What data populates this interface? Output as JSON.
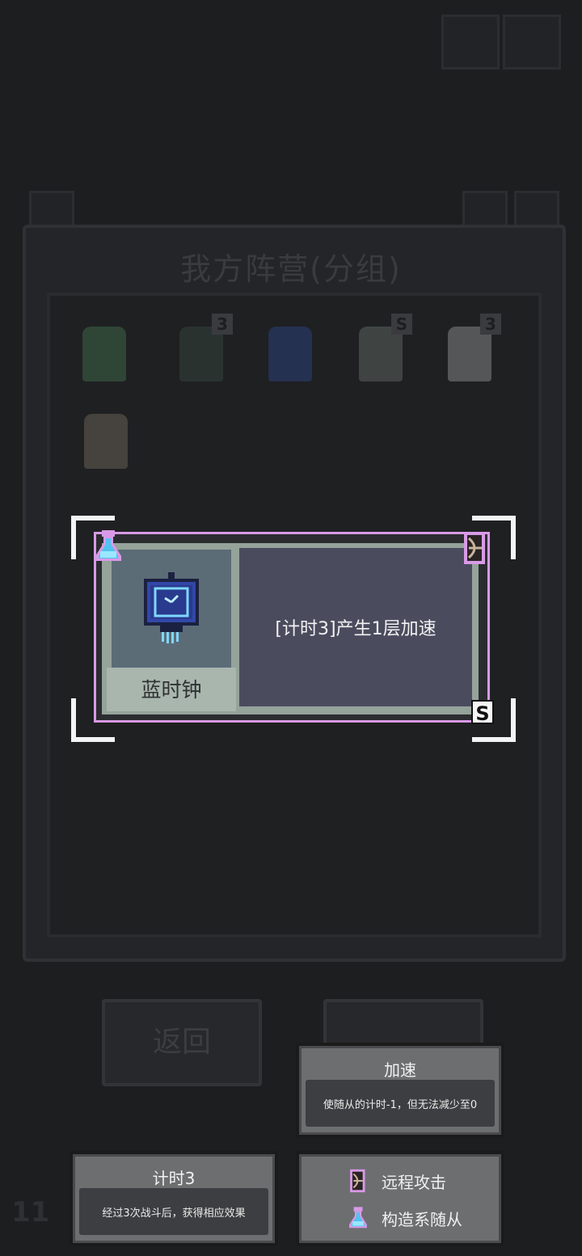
{
  "background": {
    "panel_title": "我方阵营(分组)",
    "return_button": "返回",
    "level_number": "11",
    "units": [
      {
        "name": "horned-warrior",
        "color": "#3c5a44",
        "badge": ""
      },
      {
        "name": "hooded-swordsman",
        "color": "#303a38",
        "badge": "3"
      },
      {
        "name": "blue-clock",
        "color": "#2c3a62",
        "badge": ""
      },
      {
        "name": "skeleton",
        "color": "#5d6462",
        "badge": "S"
      },
      {
        "name": "fox-spirit",
        "color": "#8a8a8a",
        "badge": "3"
      },
      {
        "name": "goat-sage",
        "color": "#6e6660",
        "badge": ""
      }
    ]
  },
  "card": {
    "name": "蓝时钟",
    "description": "[计时3]产生1层加速",
    "rank": "S",
    "accent_color": "#d89ae6"
  },
  "tooltips": {
    "haste": {
      "title": "加速",
      "text": "使随从的计时-1，但无法减少至0"
    },
    "timer": {
      "title": "计时3",
      "text": "经过3次战斗后，获得相应效果"
    },
    "tags": [
      {
        "icon": "ranged-attack-icon",
        "label": "远程攻击"
      },
      {
        "icon": "construct-flask-icon",
        "label": "构造系随从"
      }
    ]
  }
}
